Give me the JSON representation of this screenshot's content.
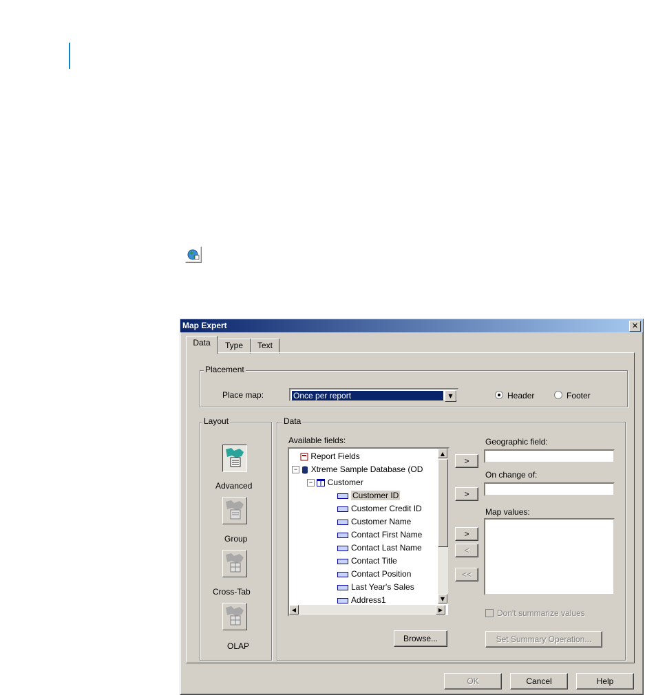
{
  "dialog": {
    "title": "Map Expert",
    "close_glyph": "✕",
    "tabs": [
      {
        "label": "Data",
        "active": true
      },
      {
        "label": "Type",
        "active": false
      },
      {
        "label": "Text",
        "active": false
      }
    ],
    "placement": {
      "legend": "Placement",
      "place_map_label": "Place map:",
      "place_map_value": "Once per report",
      "header_label": "Header",
      "footer_label": "Footer",
      "selected": "Header"
    },
    "layout": {
      "legend": "Layout",
      "options": [
        {
          "label": "Advanced",
          "active": true
        },
        {
          "label": "Group",
          "active": false
        },
        {
          "label": "Cross-Tab",
          "active": false
        },
        {
          "label": "OLAP",
          "active": false
        }
      ]
    },
    "data": {
      "legend": "Data",
      "available_fields_label": "Available fields:",
      "tree": {
        "report_fields": "Report Fields",
        "database": "Xtreme Sample Database (OD",
        "table": "Customer",
        "fields": [
          "Customer ID",
          "Customer Credit ID",
          "Customer Name",
          "Contact First Name",
          "Contact Last Name",
          "Contact Title",
          "Contact Position",
          "Last Year's Sales",
          "Address1"
        ],
        "selected_field": "Customer ID"
      },
      "browse_button": "Browse...",
      "move_buttons": [
        ">",
        ">",
        ">",
        "<",
        "<<"
      ],
      "geographic_field_label": "Geographic field:",
      "on_change_of_label": "On change of:",
      "map_values_label": "Map values:",
      "dont_summarize_label": "Don't summarize values",
      "set_summary_button": "Set Summary Operation..."
    },
    "footer_buttons": {
      "ok": "OK",
      "cancel": "Cancel",
      "help": "Help"
    }
  },
  "colors": {
    "titlebar": "#0a246a",
    "face": "#d4d0c8",
    "accent_bar": "#0a84c6"
  }
}
